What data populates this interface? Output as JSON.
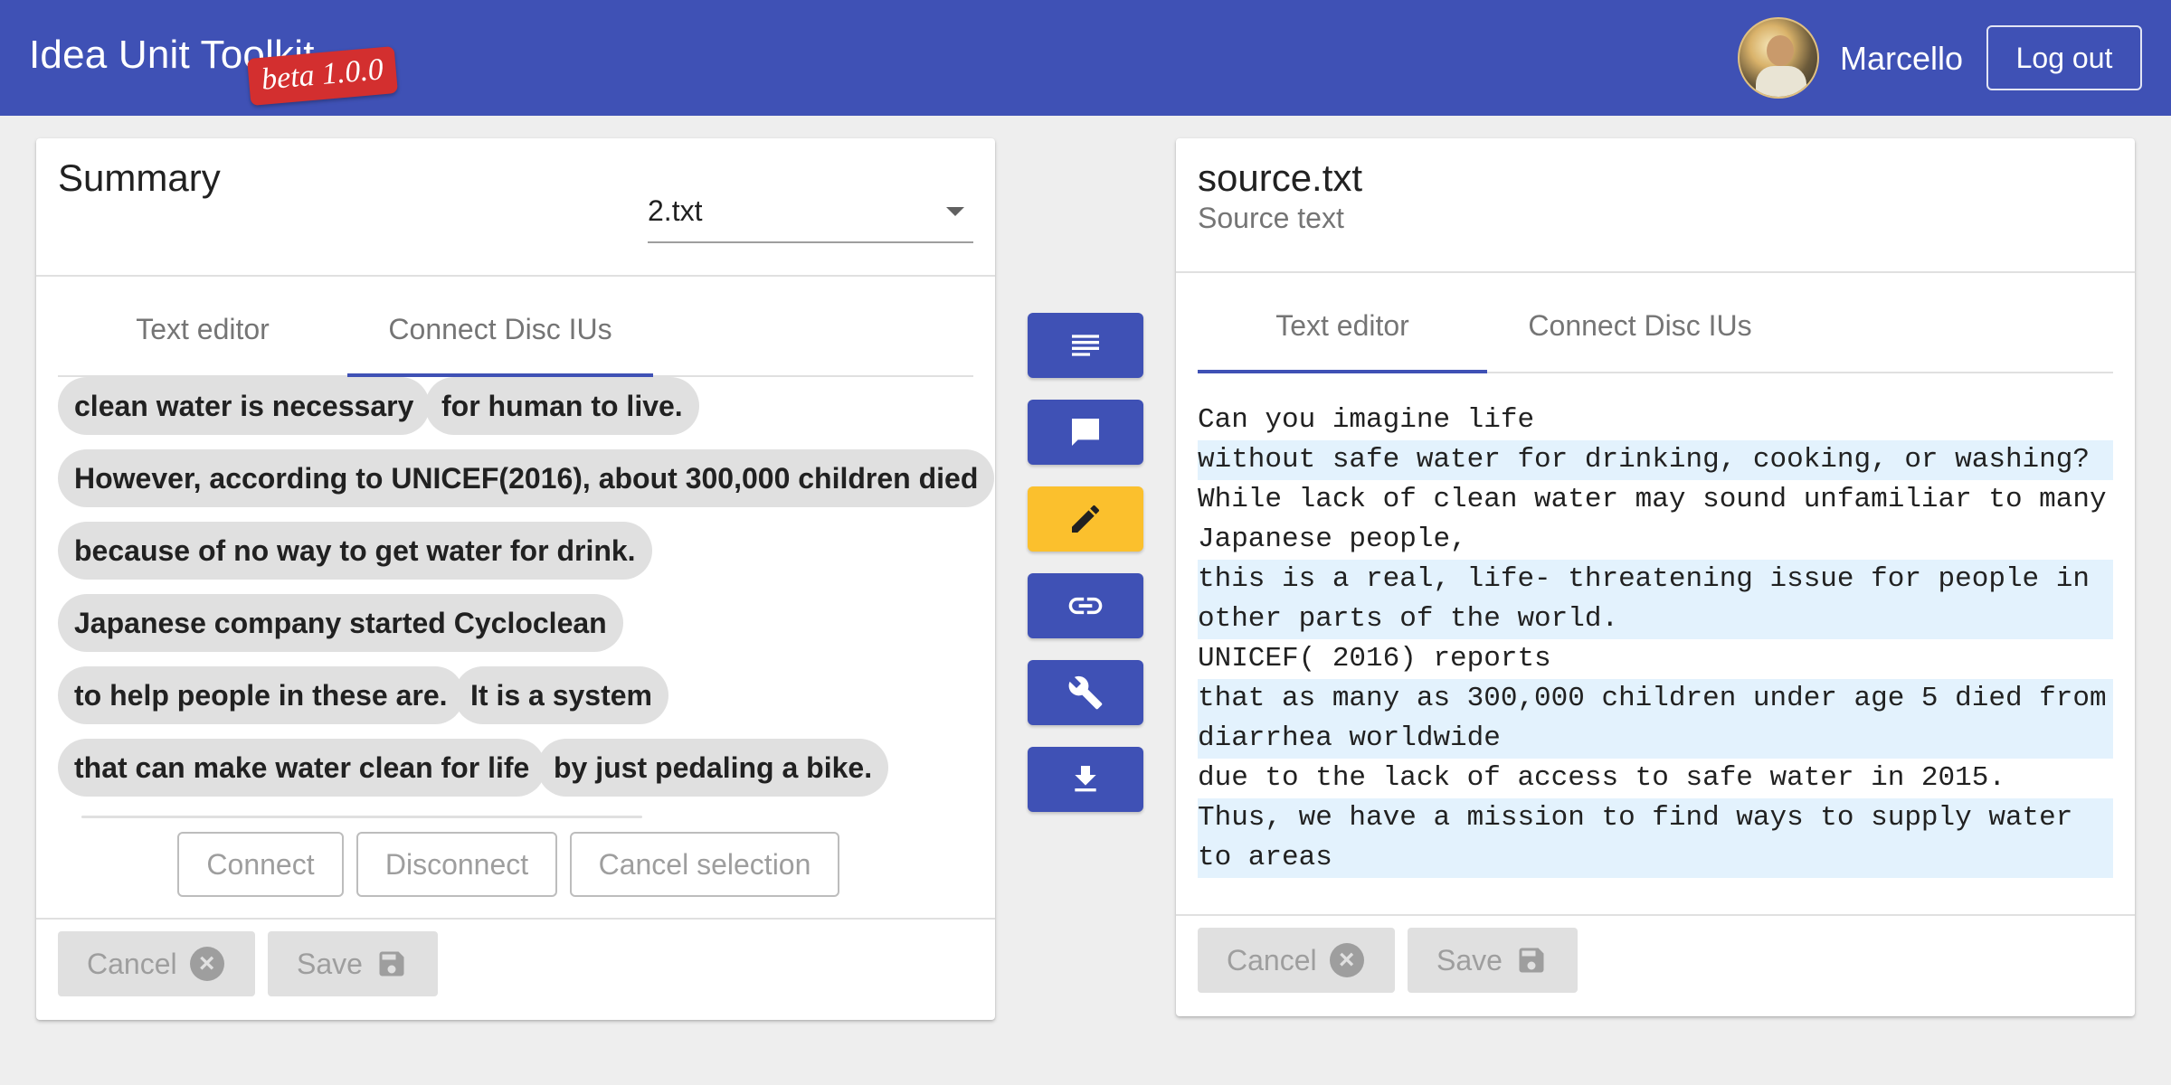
{
  "app": {
    "title": "Idea Unit Toolkit",
    "version_badge": "beta 1.0.0",
    "user_name": "Marcello",
    "logout_label": "Log out",
    "colors": {
      "primary": "#3f51b5",
      "badge": "#d32f2f",
      "accent": "#fbc02d",
      "highlight": "#e3f2fd"
    }
  },
  "summary_panel": {
    "title": "Summary",
    "selected_file": "2.txt",
    "tabs": [
      {
        "label": "Text editor",
        "active": false
      },
      {
        "label": "Connect Disc IUs",
        "active": true
      }
    ],
    "chips": [
      "clean water is necessary",
      "for human to live.",
      "However, according to UNICEF(2016), about 300,000 children died",
      "because of no way to get water for drink.",
      "Japanese company started Cycloclean",
      "to help people in these are.",
      "It is a system",
      "that can make water clean for life",
      "by just pedaling a bike."
    ],
    "actions": {
      "connect": "Connect",
      "disconnect": "Disconnect",
      "cancel_selection": "Cancel selection"
    },
    "footer": {
      "cancel": "Cancel",
      "save": "Save"
    }
  },
  "toolbar": {
    "buttons": [
      {
        "icon": "text-lines-icon",
        "active": false
      },
      {
        "icon": "comment-icon",
        "active": false
      },
      {
        "icon": "pencil-icon",
        "active": true
      },
      {
        "icon": "link-icon",
        "active": false
      },
      {
        "icon": "wrench-icon",
        "active": false
      },
      {
        "icon": "download-icon",
        "active": false
      }
    ]
  },
  "source_panel": {
    "title": "source.txt",
    "subtitle": "Source text",
    "tabs": [
      {
        "label": "Text editor",
        "active": true
      },
      {
        "label": "Connect Disc IUs",
        "active": false
      }
    ],
    "lines": [
      {
        "text": "Can you imagine life",
        "highlighted": false
      },
      {
        "text": "without safe water for drinking, cooking, or washing?",
        "highlighted": true
      },
      {
        "text": "While lack of clean water may sound unfamiliar to many Japanese people,",
        "highlighted": false
      },
      {
        "text": "this is a real, life- threatening issue for people in other parts of the world.",
        "highlighted": true
      },
      {
        "text": "UNICEF( 2016) reports",
        "highlighted": false
      },
      {
        "text": "that as many as 300,000 children under age 5 died from diarrhea worldwide",
        "highlighted": true
      },
      {
        "text": "due to the lack of access to safe water in 2015.",
        "highlighted": false
      },
      {
        "text": "Thus, we have a mission to find ways to supply water to areas",
        "highlighted": true
      }
    ],
    "footer": {
      "cancel": "Cancel",
      "save": "Save"
    }
  }
}
